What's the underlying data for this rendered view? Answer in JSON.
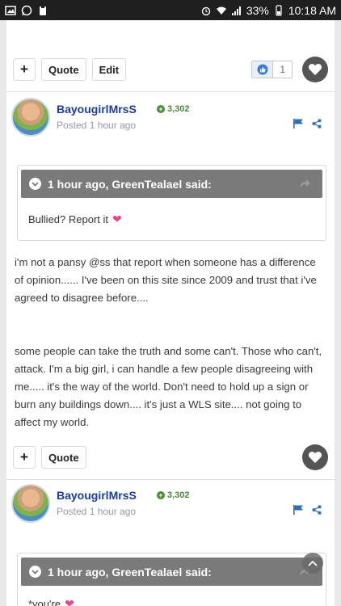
{
  "status_bar": {
    "battery": "33%",
    "time": "10:18 AM"
  },
  "post1": {
    "buttons": {
      "add": "+",
      "quote": "Quote",
      "edit": "Edit"
    },
    "reaction_count": "1",
    "author": {
      "name": "BayougirlMrsS",
      "reputation": "3,302",
      "posted": "Posted",
      "time": "1 hour ago"
    },
    "quote": {
      "header": "1 hour ago, GreenTealael said:",
      "body": "Bullied? Report it"
    },
    "paragraphs": [
      "i'm not a pansy @ss that report when someone has a difference of opinion...... I've been on this site since 2009 and trust that i've agreed to disagree before....",
      "some people can take the truth and some can't. Those who can't, attack. I'm a big girl, i can handle a few people disagreeing with me..... it's the way of the world. Don't need to hold up a sign or burn any buildings down.... it's just a WLS site.... not going to affect my world."
    ]
  },
  "post2": {
    "buttons": {
      "add": "+",
      "quote": "Quote"
    },
    "author": {
      "name": "BayougirlMrsS",
      "reputation": "3,302",
      "posted": "Posted",
      "time": "1 hour ago"
    },
    "quote": {
      "header": "1 hour ago, GreenTealael said:",
      "body": "*you're"
    }
  },
  "colors": {
    "link_blue": "#1b3c99",
    "rep_green": "#4a8a38",
    "heart_pink": "#e2468c",
    "quote_header": "#7a7a7a"
  }
}
